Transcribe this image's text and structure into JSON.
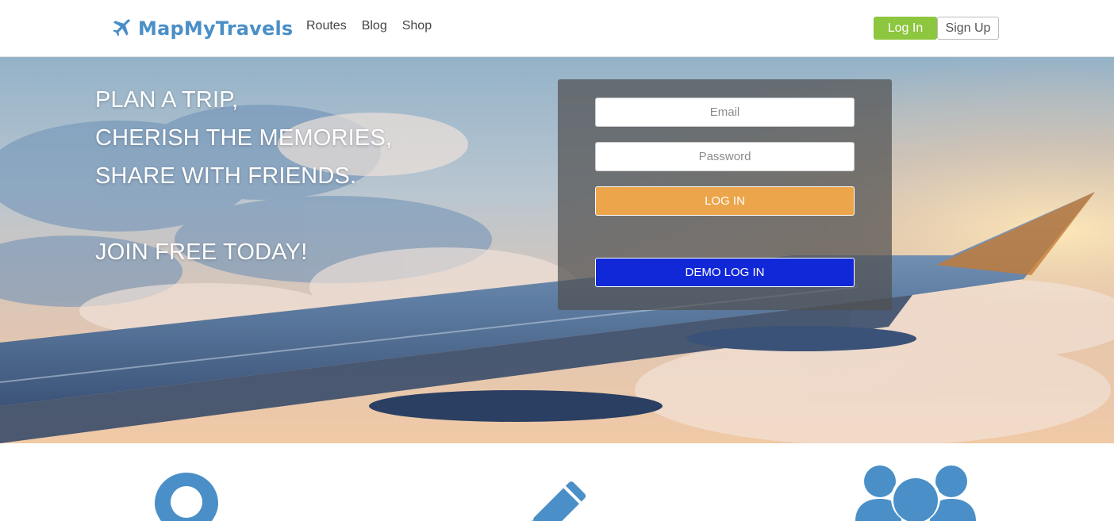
{
  "brand": {
    "name": "MapMyTravels",
    "icon": "airplane-icon",
    "color": "#4a8fc7"
  },
  "nav": {
    "links": [
      "Routes",
      "Blog",
      "Shop"
    ]
  },
  "auth": {
    "login_label": "Log In",
    "signup_label": "Sign Up",
    "login_color": "#8dc63f"
  },
  "hero": {
    "taglines": [
      "PLAN A TRIP,",
      "CHERISH THE MEMORIES,",
      "SHARE WITH FRIENDS."
    ],
    "cta": "JOIN FREE TODAY!"
  },
  "login_form": {
    "email_placeholder": "Email",
    "password_placeholder": "Password",
    "login_button": "LOG IN",
    "login_button_color": "#eca54a",
    "demo_button": "DEMO LOG IN",
    "demo_button_color": "#1128d8"
  },
  "features": {
    "icons": [
      "map-pin-icon",
      "pencil-icon",
      "people-icon"
    ],
    "color": "#4a8fc7"
  }
}
